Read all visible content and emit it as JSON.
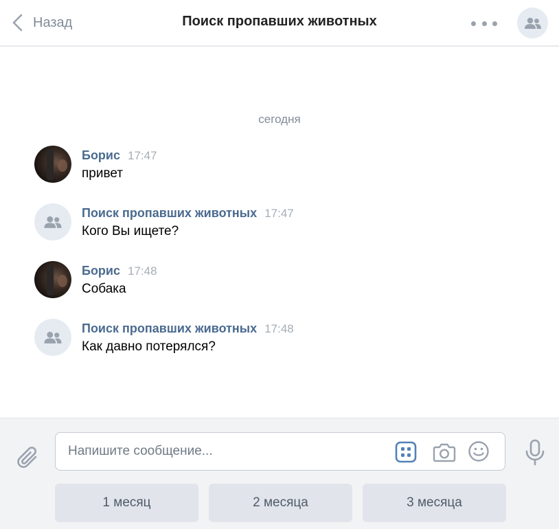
{
  "header": {
    "back_label": "Назад",
    "title": "Поиск пропавших животных"
  },
  "chat": {
    "day_separator": "сегодня",
    "messages": [
      {
        "author": "Борис",
        "time": "17:47",
        "text": "привет",
        "avatar": "user-photo"
      },
      {
        "author": "Поиск пропавших животных",
        "time": "17:47",
        "text": "Кого Вы ищете?",
        "avatar": "community-icon"
      },
      {
        "author": "Борис",
        "time": "17:48",
        "text": "Собака",
        "avatar": "user-photo"
      },
      {
        "author": "Поиск пропавших животных",
        "time": "17:48",
        "text": "Как давно потерялся?",
        "avatar": "community-icon"
      }
    ]
  },
  "composer": {
    "placeholder": "Напишите сообщение...",
    "value": "",
    "quick_replies": [
      "1 месяц",
      "2 месяца",
      "3 месяца"
    ]
  },
  "colors": {
    "accent": "#4a6a8f",
    "icon_blue": "#5181b8",
    "icon_gray": "#99a2ad",
    "avatar_bg": "#e5ebf1",
    "button_bg": "#e1e5eb"
  }
}
